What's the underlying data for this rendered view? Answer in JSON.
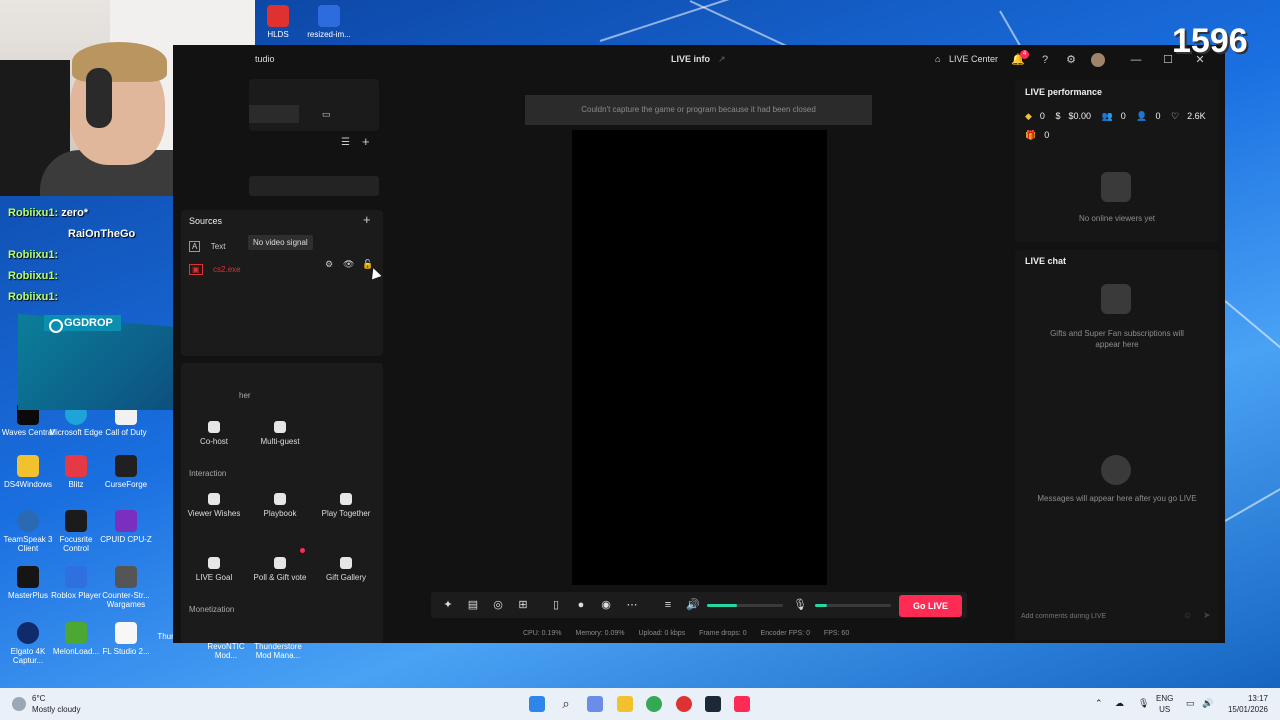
{
  "desktop": {
    "top_icons": [
      {
        "label": "HLDS",
        "color": "#e03131"
      },
      {
        "label": "resized-im...",
        "color": "#2d6cdf"
      }
    ],
    "left_icons": [
      {
        "label": "Waves Central",
        "color": "#0a0a0a"
      },
      {
        "label": "Microsoft Edge",
        "color": "#1ea4d9"
      },
      {
        "label": "Call of Duty",
        "color": "#f1f1f1"
      },
      {
        "label": "DS4Windows",
        "color": "#f2c12e"
      },
      {
        "label": "Blitz",
        "color": "#e63946"
      },
      {
        "label": "CurseForge",
        "color": "#202020"
      },
      {
        "label": "TeamSpeak 3 Client",
        "color": "#2a6ab3"
      },
      {
        "label": "Focusrite Control",
        "color": "#1b1b1b"
      },
      {
        "label": "CPUID CPU-Z",
        "color": "#7b2fbe"
      },
      {
        "label": "MasterPlus",
        "color": "#151515"
      },
      {
        "label": "Roblox Player",
        "color": "#2f6fe0"
      },
      {
        "label": "Counter-Str... Wargames",
        "color": "#555"
      },
      {
        "label": "Elgato 4K Captur...",
        "color": "#0f2b6b"
      },
      {
        "label": "MelonLoad...",
        "color": "#4ca832"
      },
      {
        "label": "FL Studio 2...",
        "color": "#f7f7f7"
      },
      {
        "label": "Thumbnails",
        "color": "#f2c12e"
      },
      {
        "label": "RevoNTIC Mod...",
        "color": "#444"
      },
      {
        "label": "Thunderstore Mod Mana...",
        "color": "#2a2a2a"
      }
    ]
  },
  "overlay": {
    "chat": [
      {
        "user": "Robiixu1:",
        "msg": "zero*"
      },
      {
        "user": "RaiOnTheGo",
        "msg": ""
      },
      {
        "user": "Robiixu1:",
        "msg": ""
      },
      {
        "user": "Robiixu1:",
        "msg": ""
      },
      {
        "user": "Robiixu1:",
        "msg": ""
      }
    ],
    "ggdrop": "GGDROP",
    "counter": "1596"
  },
  "app": {
    "title_fragment": "tudio",
    "tab_title": "LIVE info",
    "live_center": "LIVE Center",
    "notification_count": "4",
    "sources": {
      "header": "Sources",
      "items": [
        {
          "label": "Text",
          "icon": "text-source-icon"
        },
        {
          "label": "cs2.exe",
          "icon": "game-source-icon"
        }
      ],
      "tooltip": "No video signal"
    },
    "section_cut": "her",
    "tools_top": [
      {
        "label": "Co-host"
      },
      {
        "label": "Multi-guest"
      }
    ],
    "interaction_header": "Interaction",
    "interaction_tools": [
      {
        "label": "Viewer Wishes"
      },
      {
        "label": "Playbook"
      },
      {
        "label": "Play Together"
      },
      {
        "label": "LIVE Goal"
      },
      {
        "label": "Poll & Gift vote"
      },
      {
        "label": "Gift Gallery"
      }
    ],
    "monetization_header": "Monetization",
    "preview_warning": "Couldn't capture the game or program because it had been closed",
    "go_live": "Go LIVE",
    "stats": {
      "cpu": "CPU: 0.19%",
      "memory": "Memory: 0.09%",
      "upload": "Upload: 0 kbps",
      "frame_drops": "Frame drops: 0",
      "encoder_fps": "Encoder FPS: 0",
      "fps": "FPS: 60"
    },
    "volume_level": 0.4,
    "mic_level": 0.16,
    "performance": {
      "title": "LIVE performance",
      "diamonds": "0",
      "money": "$0.00",
      "viewers": "0",
      "new_followers": "0",
      "likes": "2.6K",
      "gifts": "0",
      "empty": "No online viewers yet"
    },
    "chat": {
      "title": "LIVE chat",
      "subs_msg": "Gifts and Super Fan subscriptions will appear here",
      "messages_msg": "Messages will appear here after you go LIVE",
      "input_placeholder": "Add comments during LIVE"
    }
  },
  "taskbar": {
    "weather_temp": "6°C",
    "weather_desc": "Mostly cloudy",
    "lang": "ENG",
    "region": "US",
    "time": "13:17",
    "date": "15/01/2026"
  },
  "colors": {
    "accent": "#fe2c55",
    "audio": "#25d7a2"
  }
}
